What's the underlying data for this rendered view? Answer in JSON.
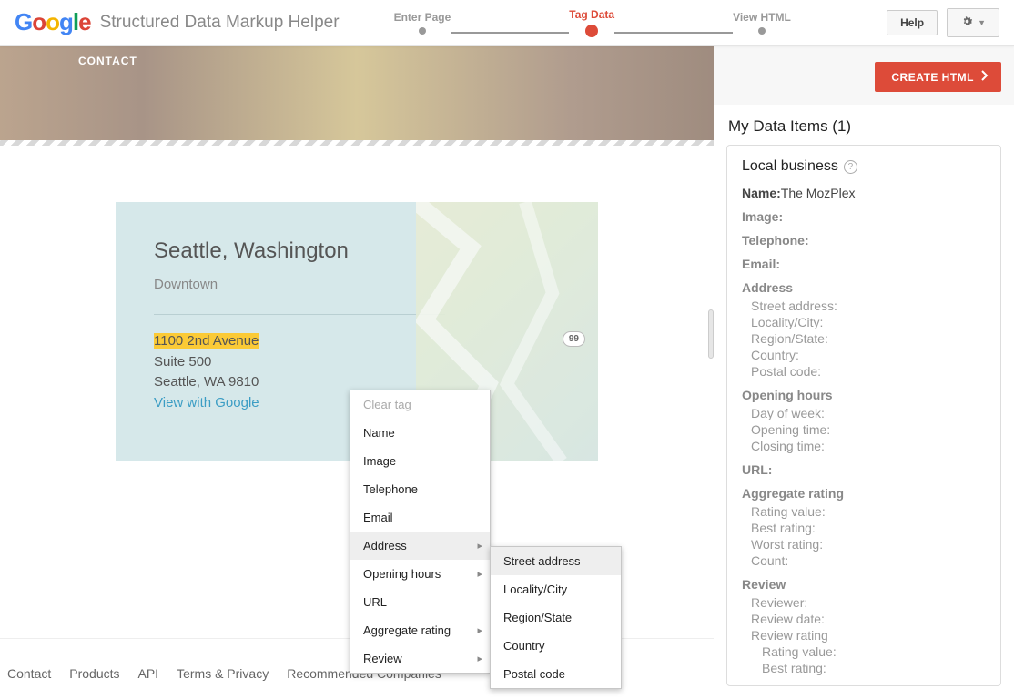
{
  "header": {
    "app_title": "Structured Data Markup Helper",
    "steps": {
      "s1": "Enter Page",
      "s2": "Tag Data",
      "s3": "View HTML"
    },
    "help": "Help"
  },
  "hero": {
    "contact": "CONTACT"
  },
  "card": {
    "city": "Seattle, Washington",
    "sub": "Downtown",
    "addr1": "1100 2nd Avenue",
    "addr2": "Suite 500",
    "addr3": "Seattle, WA 9810",
    "view": "View with Google",
    "badge": "99"
  },
  "ctx": {
    "clear": "Clear tag",
    "items": [
      "Name",
      "Image",
      "Telephone",
      "Email",
      "Address",
      "Opening hours",
      "URL",
      "Aggregate rating",
      "Review"
    ],
    "sub_address": [
      "Street address",
      "Locality/City",
      "Region/State",
      "Country",
      "Postal code"
    ]
  },
  "footer": [
    "Contact",
    "Products",
    "API",
    "Terms & Privacy",
    "Recommended Companies"
  ],
  "right": {
    "create": "CREATE HTML",
    "heading": "My Data Items (1)",
    "schema": "Local business",
    "name_label": "Name:",
    "name_value": "The MozPlex",
    "image": "Image:",
    "telephone": "Telephone:",
    "email": "Email:",
    "address": "Address",
    "address_sub": [
      "Street address:",
      "Locality/City:",
      "Region/State:",
      "Country:",
      "Postal code:"
    ],
    "hours": "Opening hours",
    "hours_sub": [
      "Day of week:",
      "Opening time:",
      "Closing time:"
    ],
    "url": "URL:",
    "agg": "Aggregate rating",
    "agg_sub": [
      "Rating value:",
      "Best rating:",
      "Worst rating:",
      "Count:"
    ],
    "review": "Review",
    "review_sub": [
      "Reviewer:",
      "Review date:",
      "Review rating"
    ],
    "review_rating_sub": [
      "Rating value:",
      "Best rating:"
    ]
  }
}
